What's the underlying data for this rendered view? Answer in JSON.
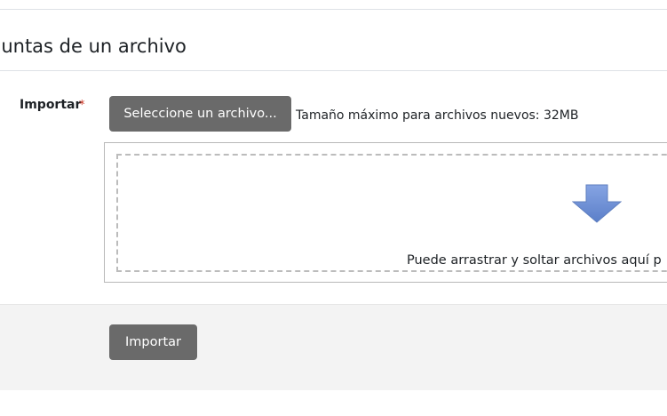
{
  "section": {
    "title": "guntas de un archivo"
  },
  "import_field": {
    "label": "Importar",
    "required_marker": "*",
    "choose_button_label": "Seleccione un archivo...",
    "max_size_text": "Tamaño máximo para archivos nuevos: 32MB",
    "drop_text": "Puede arrastrar y soltar archivos aquí p",
    "drop_icon": "arrow-down-icon"
  },
  "footer": {
    "submit_label": "Importar"
  },
  "colors": {
    "button": "#6a6a6a",
    "required": "#ca3120",
    "arrow": "#6d8fd2"
  }
}
